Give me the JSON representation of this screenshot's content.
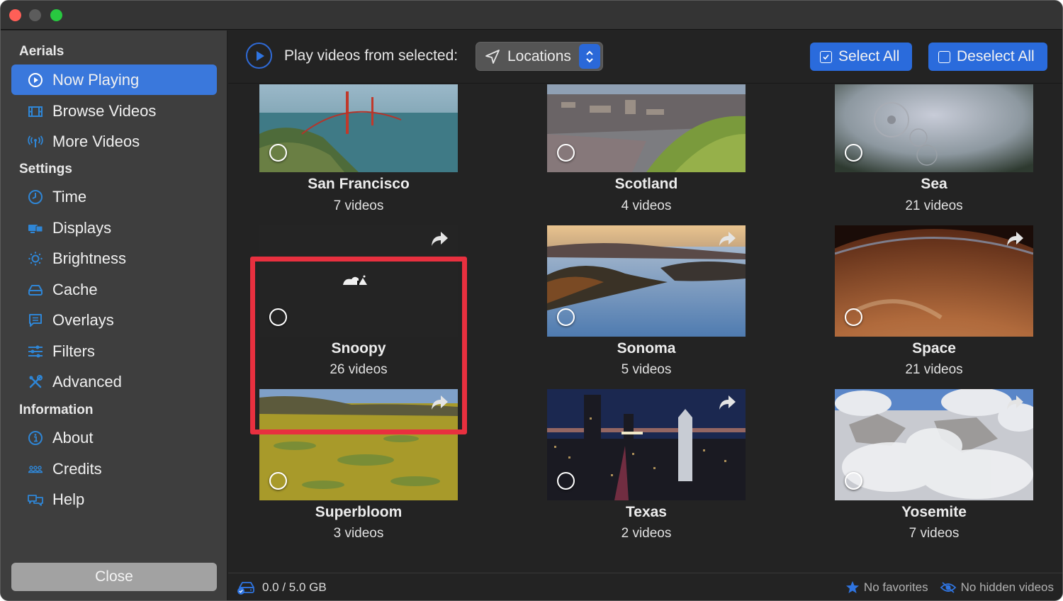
{
  "window": {
    "traffic_lights": [
      "close",
      "minimize",
      "maximize"
    ]
  },
  "sidebar": {
    "sections": [
      {
        "title": "Aerials",
        "items": [
          {
            "label": "Now Playing",
            "icon": "play-circle-icon",
            "active": true
          },
          {
            "label": "Browse Videos",
            "icon": "film-icon",
            "active": false
          },
          {
            "label": "More Videos",
            "icon": "antenna-icon",
            "active": false
          }
        ]
      },
      {
        "title": "Settings",
        "items": [
          {
            "label": "Time",
            "icon": "clock-icon",
            "active": false
          },
          {
            "label": "Displays",
            "icon": "displays-icon",
            "active": false
          },
          {
            "label": "Brightness",
            "icon": "sun-icon",
            "active": false
          },
          {
            "label": "Cache",
            "icon": "drive-icon",
            "active": false
          },
          {
            "label": "Overlays",
            "icon": "message-icon",
            "active": false
          },
          {
            "label": "Filters",
            "icon": "sliders-icon",
            "active": false
          },
          {
            "label": "Advanced",
            "icon": "tools-icon",
            "active": false
          }
        ]
      },
      {
        "title": "Information",
        "items": [
          {
            "label": "About",
            "icon": "info-icon",
            "active": false
          },
          {
            "label": "Credits",
            "icon": "people-icon",
            "active": false
          },
          {
            "label": "Help",
            "icon": "chat-bubbles-icon",
            "active": false
          }
        ]
      }
    ],
    "close_label": "Close"
  },
  "toolbar": {
    "play_label": "Play videos from selected:",
    "source_selected": "Locations",
    "select_all_label": "Select All",
    "deselect_all_label": "Deselect All"
  },
  "tiles": [
    {
      "name": "San Francisco",
      "count": "7 videos",
      "selected": false,
      "scene": "san-francisco"
    },
    {
      "name": "Scotland",
      "count": "4 videos",
      "selected": false,
      "scene": "scotland"
    },
    {
      "name": "Sea",
      "count": "21 videos",
      "selected": false,
      "scene": "sea"
    },
    {
      "name": "Snoopy",
      "count": "26 videos",
      "selected": false,
      "scene": "snoopy",
      "highlighted": true
    },
    {
      "name": "Sonoma",
      "count": "5 videos",
      "selected": false,
      "scene": "sonoma"
    },
    {
      "name": "Space",
      "count": "21 videos",
      "selected": false,
      "scene": "space"
    },
    {
      "name": "Superbloom",
      "count": "3 videos",
      "selected": false,
      "scene": "superbloom"
    },
    {
      "name": "Texas",
      "count": "2 videos",
      "selected": false,
      "scene": "texas"
    },
    {
      "name": "Yosemite",
      "count": "7 videos",
      "selected": false,
      "scene": "yosemite"
    }
  ],
  "statusbar": {
    "cache_usage": "0.0 / 5.0 GB",
    "favorites": "No favorites",
    "hidden": "No hidden videos"
  },
  "colors": {
    "accent": "#2a6bdc",
    "sidebar_active": "#3a78dc",
    "icon_blue": "#2f86d6",
    "highlight_red": "#e8303f"
  }
}
